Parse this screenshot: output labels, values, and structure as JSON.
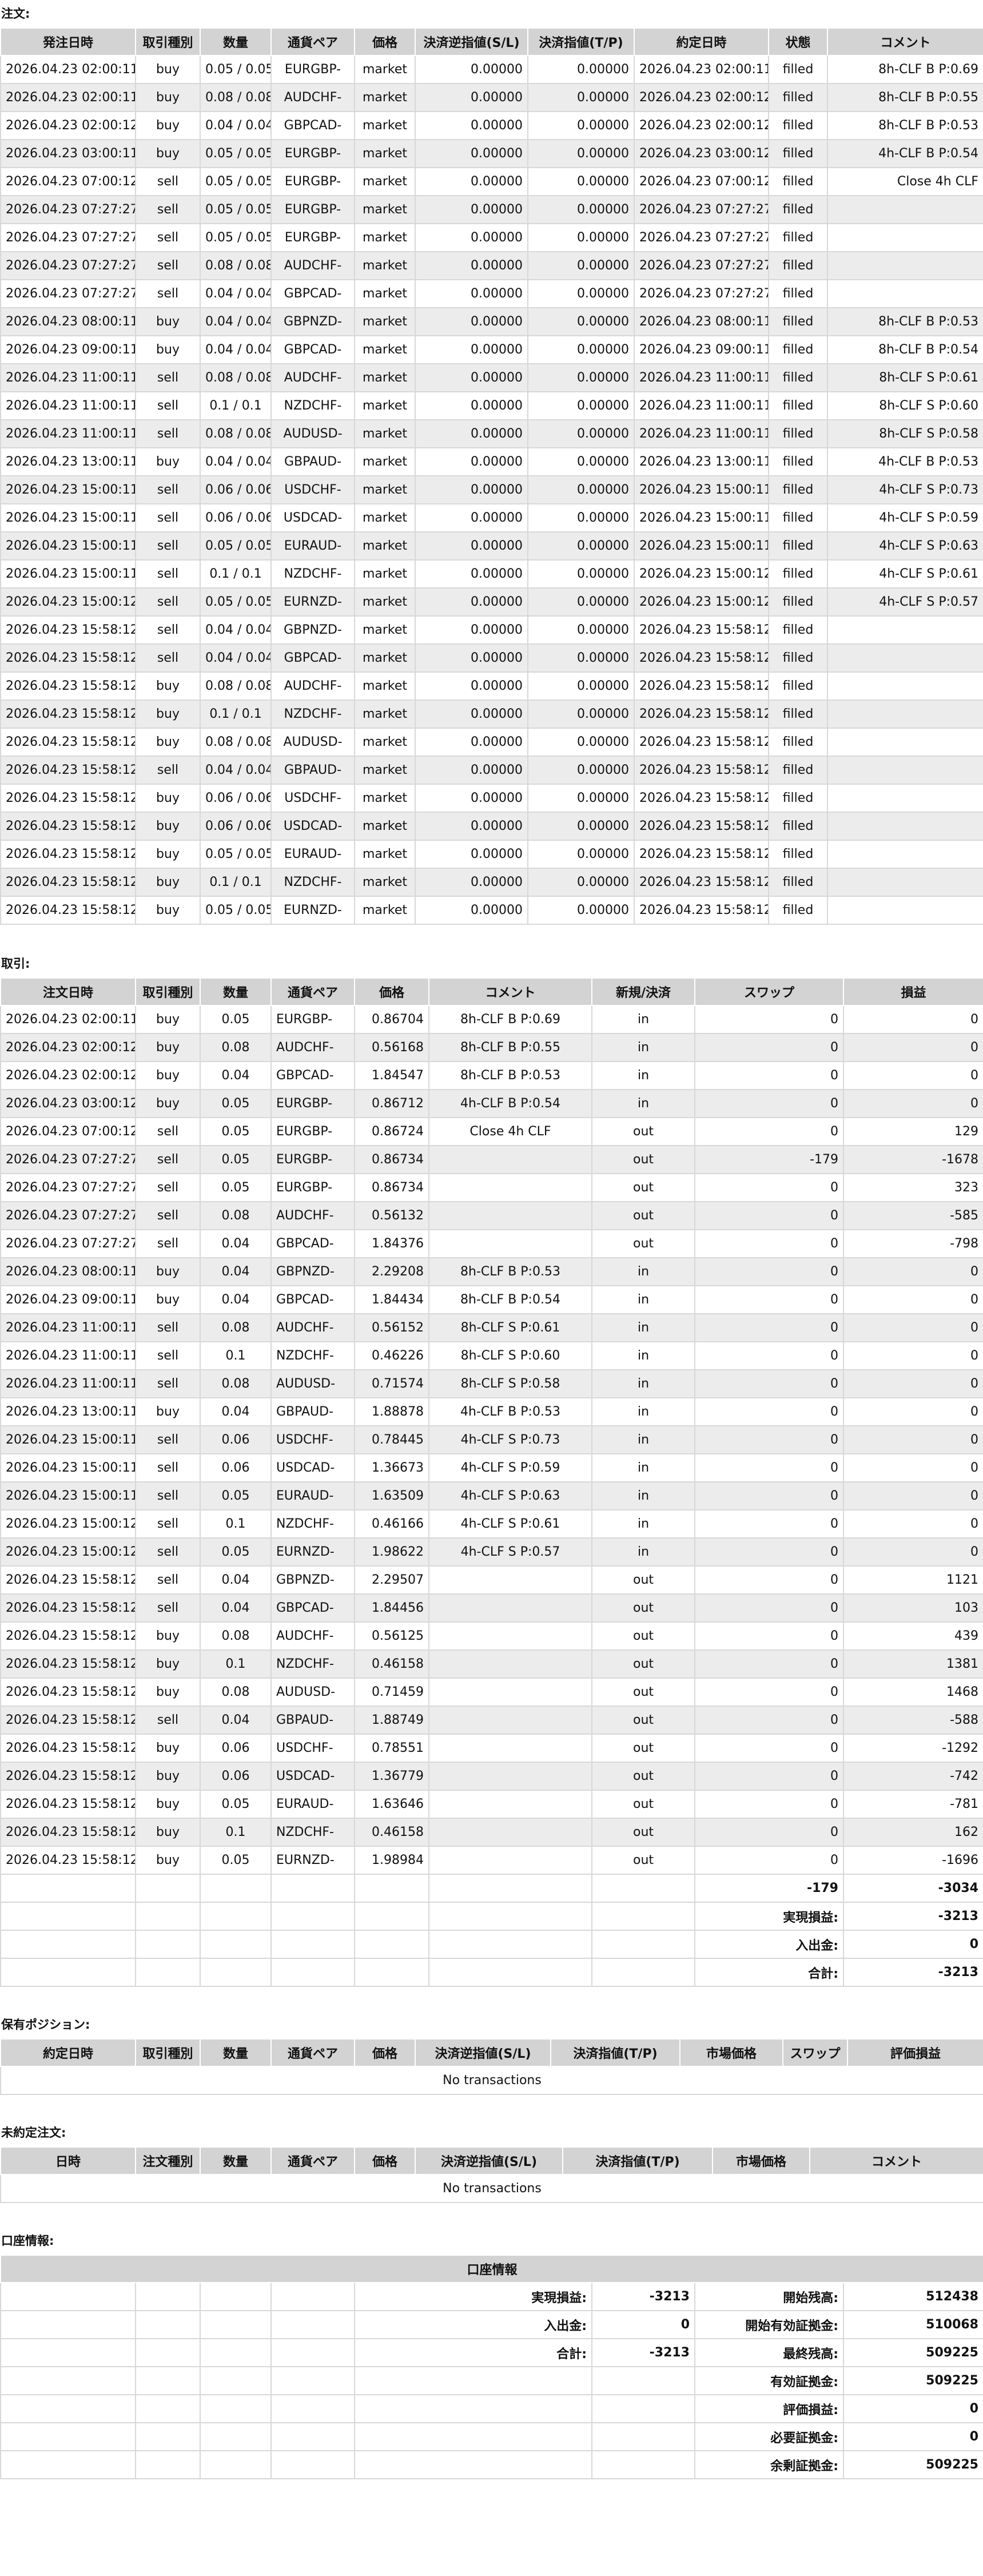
{
  "orders": {
    "title": "注文:",
    "headers": [
      "発注日時",
      "取引種別",
      "数量",
      "通貨ペア",
      "価格",
      "決済逆指値(S/L)",
      "決済指値(T/P)",
      "約定日時",
      "状態",
      "コメント"
    ],
    "rows": [
      [
        "2026.04.23 02:00:11",
        "buy",
        "0.05 / 0.05",
        "EURGBP-",
        "market",
        "0.00000",
        "0.00000",
        "2026.04.23 02:00:11",
        "filled",
        "8h-CLF B P:0.69"
      ],
      [
        "2026.04.23 02:00:11",
        "buy",
        "0.08 / 0.08",
        "AUDCHF-",
        "market",
        "0.00000",
        "0.00000",
        "2026.04.23 02:00:12",
        "filled",
        "8h-CLF B P:0.55"
      ],
      [
        "2026.04.23 02:00:12",
        "buy",
        "0.04 / 0.04",
        "GBPCAD-",
        "market",
        "0.00000",
        "0.00000",
        "2026.04.23 02:00:12",
        "filled",
        "8h-CLF B P:0.53"
      ],
      [
        "2026.04.23 03:00:11",
        "buy",
        "0.05 / 0.05",
        "EURGBP-",
        "market",
        "0.00000",
        "0.00000",
        "2026.04.23 03:00:12",
        "filled",
        "4h-CLF B P:0.54"
      ],
      [
        "2026.04.23 07:00:12",
        "sell",
        "0.05 / 0.05",
        "EURGBP-",
        "market",
        "0.00000",
        "0.00000",
        "2026.04.23 07:00:12",
        "filled",
        "Close 4h CLF"
      ],
      [
        "2026.04.23 07:27:27",
        "sell",
        "0.05 / 0.05",
        "EURGBP-",
        "market",
        "0.00000",
        "0.00000",
        "2026.04.23 07:27:27",
        "filled",
        ""
      ],
      [
        "2026.04.23 07:27:27",
        "sell",
        "0.05 / 0.05",
        "EURGBP-",
        "market",
        "0.00000",
        "0.00000",
        "2026.04.23 07:27:27",
        "filled",
        ""
      ],
      [
        "2026.04.23 07:27:27",
        "sell",
        "0.08 / 0.08",
        "AUDCHF-",
        "market",
        "0.00000",
        "0.00000",
        "2026.04.23 07:27:27",
        "filled",
        ""
      ],
      [
        "2026.04.23 07:27:27",
        "sell",
        "0.04 / 0.04",
        "GBPCAD-",
        "market",
        "0.00000",
        "0.00000",
        "2026.04.23 07:27:27",
        "filled",
        ""
      ],
      [
        "2026.04.23 08:00:11",
        "buy",
        "0.04 / 0.04",
        "GBPNZD-",
        "market",
        "0.00000",
        "0.00000",
        "2026.04.23 08:00:11",
        "filled",
        "8h-CLF B P:0.53"
      ],
      [
        "2026.04.23 09:00:11",
        "buy",
        "0.04 / 0.04",
        "GBPCAD-",
        "market",
        "0.00000",
        "0.00000",
        "2026.04.23 09:00:11",
        "filled",
        "8h-CLF B P:0.54"
      ],
      [
        "2026.04.23 11:00:11",
        "sell",
        "0.08 / 0.08",
        "AUDCHF-",
        "market",
        "0.00000",
        "0.00000",
        "2026.04.23 11:00:11",
        "filled",
        "8h-CLF S P:0.61"
      ],
      [
        "2026.04.23 11:00:11",
        "sell",
        "0.1 / 0.1",
        "NZDCHF-",
        "market",
        "0.00000",
        "0.00000",
        "2026.04.23 11:00:11",
        "filled",
        "8h-CLF S P:0.60"
      ],
      [
        "2026.04.23 11:00:11",
        "sell",
        "0.08 / 0.08",
        "AUDUSD-",
        "market",
        "0.00000",
        "0.00000",
        "2026.04.23 11:00:11",
        "filled",
        "8h-CLF S P:0.58"
      ],
      [
        "2026.04.23 13:00:11",
        "buy",
        "0.04 / 0.04",
        "GBPAUD-",
        "market",
        "0.00000",
        "0.00000",
        "2026.04.23 13:00:11",
        "filled",
        "4h-CLF B P:0.53"
      ],
      [
        "2026.04.23 15:00:11",
        "sell",
        "0.06 / 0.06",
        "USDCHF-",
        "market",
        "0.00000",
        "0.00000",
        "2026.04.23 15:00:11",
        "filled",
        "4h-CLF S P:0.73"
      ],
      [
        "2026.04.23 15:00:11",
        "sell",
        "0.06 / 0.06",
        "USDCAD-",
        "market",
        "0.00000",
        "0.00000",
        "2026.04.23 15:00:11",
        "filled",
        "4h-CLF S P:0.59"
      ],
      [
        "2026.04.23 15:00:11",
        "sell",
        "0.05 / 0.05",
        "EURAUD-",
        "market",
        "0.00000",
        "0.00000",
        "2026.04.23 15:00:11",
        "filled",
        "4h-CLF S P:0.63"
      ],
      [
        "2026.04.23 15:00:11",
        "sell",
        "0.1 / 0.1",
        "NZDCHF-",
        "market",
        "0.00000",
        "0.00000",
        "2026.04.23 15:00:12",
        "filled",
        "4h-CLF S P:0.61"
      ],
      [
        "2026.04.23 15:00:12",
        "sell",
        "0.05 / 0.05",
        "EURNZD-",
        "market",
        "0.00000",
        "0.00000",
        "2026.04.23 15:00:12",
        "filled",
        "4h-CLF S P:0.57"
      ],
      [
        "2026.04.23 15:58:12",
        "sell",
        "0.04 / 0.04",
        "GBPNZD-",
        "market",
        "0.00000",
        "0.00000",
        "2026.04.23 15:58:12",
        "filled",
        ""
      ],
      [
        "2026.04.23 15:58:12",
        "sell",
        "0.04 / 0.04",
        "GBPCAD-",
        "market",
        "0.00000",
        "0.00000",
        "2026.04.23 15:58:12",
        "filled",
        ""
      ],
      [
        "2026.04.23 15:58:12",
        "buy",
        "0.08 / 0.08",
        "AUDCHF-",
        "market",
        "0.00000",
        "0.00000",
        "2026.04.23 15:58:12",
        "filled",
        ""
      ],
      [
        "2026.04.23 15:58:12",
        "buy",
        "0.1 / 0.1",
        "NZDCHF-",
        "market",
        "0.00000",
        "0.00000",
        "2026.04.23 15:58:12",
        "filled",
        ""
      ],
      [
        "2026.04.23 15:58:12",
        "buy",
        "0.08 / 0.08",
        "AUDUSD-",
        "market",
        "0.00000",
        "0.00000",
        "2026.04.23 15:58:12",
        "filled",
        ""
      ],
      [
        "2026.04.23 15:58:12",
        "sell",
        "0.04 / 0.04",
        "GBPAUD-",
        "market",
        "0.00000",
        "0.00000",
        "2026.04.23 15:58:12",
        "filled",
        ""
      ],
      [
        "2026.04.23 15:58:12",
        "buy",
        "0.06 / 0.06",
        "USDCHF-",
        "market",
        "0.00000",
        "0.00000",
        "2026.04.23 15:58:12",
        "filled",
        ""
      ],
      [
        "2026.04.23 15:58:12",
        "buy",
        "0.06 / 0.06",
        "USDCAD-",
        "market",
        "0.00000",
        "0.00000",
        "2026.04.23 15:58:12",
        "filled",
        ""
      ],
      [
        "2026.04.23 15:58:12",
        "buy",
        "0.05 / 0.05",
        "EURAUD-",
        "market",
        "0.00000",
        "0.00000",
        "2026.04.23 15:58:12",
        "filled",
        ""
      ],
      [
        "2026.04.23 15:58:12",
        "buy",
        "0.1 / 0.1",
        "NZDCHF-",
        "market",
        "0.00000",
        "0.00000",
        "2026.04.23 15:58:12",
        "filled",
        ""
      ],
      [
        "2026.04.23 15:58:12",
        "buy",
        "0.05 / 0.05",
        "EURNZD-",
        "market",
        "0.00000",
        "0.00000",
        "2026.04.23 15:58:12",
        "filled",
        ""
      ]
    ]
  },
  "deals": {
    "title": "取引:",
    "headers": [
      "注文日時",
      "取引種別",
      "数量",
      "通貨ペア",
      "価格",
      "コメント",
      "新規/決済",
      "スワップ",
      "損益"
    ],
    "rows": [
      [
        "2026.04.23 02:00:11",
        "buy",
        "0.05",
        "EURGBP-",
        "0.86704",
        "8h-CLF B P:0.69",
        "in",
        "0",
        "0"
      ],
      [
        "2026.04.23 02:00:12",
        "buy",
        "0.08",
        "AUDCHF-",
        "0.56168",
        "8h-CLF B P:0.55",
        "in",
        "0",
        "0"
      ],
      [
        "2026.04.23 02:00:12",
        "buy",
        "0.04",
        "GBPCAD-",
        "1.84547",
        "8h-CLF B P:0.53",
        "in",
        "0",
        "0"
      ],
      [
        "2026.04.23 03:00:12",
        "buy",
        "0.05",
        "EURGBP-",
        "0.86712",
        "4h-CLF B P:0.54",
        "in",
        "0",
        "0"
      ],
      [
        "2026.04.23 07:00:12",
        "sell",
        "0.05",
        "EURGBP-",
        "0.86724",
        "Close 4h CLF",
        "out",
        "0",
        "129"
      ],
      [
        "2026.04.23 07:27:27",
        "sell",
        "0.05",
        "EURGBP-",
        "0.86734",
        "",
        "out",
        "-179",
        "-1678"
      ],
      [
        "2026.04.23 07:27:27",
        "sell",
        "0.05",
        "EURGBP-",
        "0.86734",
        "",
        "out",
        "0",
        "323"
      ],
      [
        "2026.04.23 07:27:27",
        "sell",
        "0.08",
        "AUDCHF-",
        "0.56132",
        "",
        "out",
        "0",
        "-585"
      ],
      [
        "2026.04.23 07:27:27",
        "sell",
        "0.04",
        "GBPCAD-",
        "1.84376",
        "",
        "out",
        "0",
        "-798"
      ],
      [
        "2026.04.23 08:00:11",
        "buy",
        "0.04",
        "GBPNZD-",
        "2.29208",
        "8h-CLF B P:0.53",
        "in",
        "0",
        "0"
      ],
      [
        "2026.04.23 09:00:11",
        "buy",
        "0.04",
        "GBPCAD-",
        "1.84434",
        "8h-CLF B P:0.54",
        "in",
        "0",
        "0"
      ],
      [
        "2026.04.23 11:00:11",
        "sell",
        "0.08",
        "AUDCHF-",
        "0.56152",
        "8h-CLF S P:0.61",
        "in",
        "0",
        "0"
      ],
      [
        "2026.04.23 11:00:11",
        "sell",
        "0.1",
        "NZDCHF-",
        "0.46226",
        "8h-CLF S P:0.60",
        "in",
        "0",
        "0"
      ],
      [
        "2026.04.23 11:00:11",
        "sell",
        "0.08",
        "AUDUSD-",
        "0.71574",
        "8h-CLF S P:0.58",
        "in",
        "0",
        "0"
      ],
      [
        "2026.04.23 13:00:11",
        "buy",
        "0.04",
        "GBPAUD-",
        "1.88878",
        "4h-CLF B P:0.53",
        "in",
        "0",
        "0"
      ],
      [
        "2026.04.23 15:00:11",
        "sell",
        "0.06",
        "USDCHF-",
        "0.78445",
        "4h-CLF S P:0.73",
        "in",
        "0",
        "0"
      ],
      [
        "2026.04.23 15:00:11",
        "sell",
        "0.06",
        "USDCAD-",
        "1.36673",
        "4h-CLF S P:0.59",
        "in",
        "0",
        "0"
      ],
      [
        "2026.04.23 15:00:11",
        "sell",
        "0.05",
        "EURAUD-",
        "1.63509",
        "4h-CLF S P:0.63",
        "in",
        "0",
        "0"
      ],
      [
        "2026.04.23 15:00:12",
        "sell",
        "0.1",
        "NZDCHF-",
        "0.46166",
        "4h-CLF S P:0.61",
        "in",
        "0",
        "0"
      ],
      [
        "2026.04.23 15:00:12",
        "sell",
        "0.05",
        "EURNZD-",
        "1.98622",
        "4h-CLF S P:0.57",
        "in",
        "0",
        "0"
      ],
      [
        "2026.04.23 15:58:12",
        "sell",
        "0.04",
        "GBPNZD-",
        "2.29507",
        "",
        "out",
        "0",
        "1121"
      ],
      [
        "2026.04.23 15:58:12",
        "sell",
        "0.04",
        "GBPCAD-",
        "1.84456",
        "",
        "out",
        "0",
        "103"
      ],
      [
        "2026.04.23 15:58:12",
        "buy",
        "0.08",
        "AUDCHF-",
        "0.56125",
        "",
        "out",
        "0",
        "439"
      ],
      [
        "2026.04.23 15:58:12",
        "buy",
        "0.1",
        "NZDCHF-",
        "0.46158",
        "",
        "out",
        "0",
        "1381"
      ],
      [
        "2026.04.23 15:58:12",
        "buy",
        "0.08",
        "AUDUSD-",
        "0.71459",
        "",
        "out",
        "0",
        "1468"
      ],
      [
        "2026.04.23 15:58:12",
        "sell",
        "0.04",
        "GBPAUD-",
        "1.88749",
        "",
        "out",
        "0",
        "-588"
      ],
      [
        "2026.04.23 15:58:12",
        "buy",
        "0.06",
        "USDCHF-",
        "0.78551",
        "",
        "out",
        "0",
        "-1292"
      ],
      [
        "2026.04.23 15:58:12",
        "buy",
        "0.06",
        "USDCAD-",
        "1.36779",
        "",
        "out",
        "0",
        "-742"
      ],
      [
        "2026.04.23 15:58:12",
        "buy",
        "0.05",
        "EURAUD-",
        "1.63646",
        "",
        "out",
        "0",
        "-781"
      ],
      [
        "2026.04.23 15:58:12",
        "buy",
        "0.1",
        "NZDCHF-",
        "0.46158",
        "",
        "out",
        "0",
        "162"
      ],
      [
        "2026.04.23 15:58:12",
        "buy",
        "0.05",
        "EURNZD-",
        "1.98984",
        "",
        "out",
        "0",
        "-1696"
      ]
    ],
    "totals": {
      "swap": "-179",
      "profit": "-3034"
    },
    "summary": [
      {
        "label": "実現損益:",
        "value": "-3213"
      },
      {
        "label": "入出金:",
        "value": "0"
      },
      {
        "label": "合計:",
        "value": "-3213"
      }
    ]
  },
  "positions": {
    "title": "保有ポジション:",
    "headers": [
      "約定日時",
      "取引種別",
      "数量",
      "通貨ペア",
      "価格",
      "決済逆指値(S/L)",
      "決済指値(T/P)",
      "市場価格",
      "スワップ",
      "評価損益"
    ],
    "empty": "No transactions"
  },
  "pending": {
    "title": "未約定注文:",
    "headers": [
      "日時",
      "注文種別",
      "数量",
      "通貨ペア",
      "価格",
      "決済逆指値(S/L)",
      "決済指値(T/P)",
      "市場価格",
      "コメント"
    ],
    "empty": "No transactions"
  },
  "account": {
    "title": "口座情報:",
    "header": "口座情報",
    "left": [
      {
        "label": "実現損益:",
        "value": "-3213"
      },
      {
        "label": "入出金:",
        "value": "0"
      },
      {
        "label": "合計:",
        "value": "-3213"
      }
    ],
    "right": [
      {
        "label": "開始残高:",
        "value": "512438"
      },
      {
        "label": "開始有効証拠金:",
        "value": "510068"
      },
      {
        "label": "最終残高:",
        "value": "509225"
      },
      {
        "label": "有効証拠金:",
        "value": "509225"
      },
      {
        "label": "評価損益:",
        "value": "0"
      },
      {
        "label": "必要証拠金:",
        "value": "0"
      },
      {
        "label": "余剰証拠金:",
        "value": "509225"
      }
    ]
  }
}
